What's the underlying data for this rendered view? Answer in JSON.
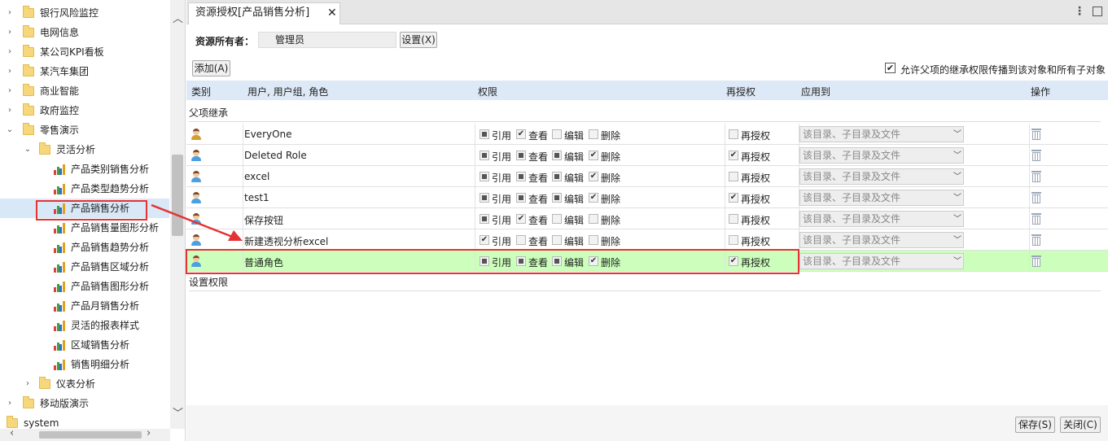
{
  "tree": {
    "items": [
      {
        "label": "银行风险监控",
        "type": "folder",
        "toggle": "›"
      },
      {
        "label": "电网信息",
        "type": "folder",
        "toggle": "›"
      },
      {
        "label": "某公司KPI看板",
        "type": "folder",
        "toggle": "›"
      },
      {
        "label": "某汽车集团",
        "type": "folder",
        "toggle": "›"
      },
      {
        "label": "商业智能",
        "type": "folder",
        "toggle": "›"
      },
      {
        "label": "政府监控",
        "type": "folder",
        "toggle": "›"
      },
      {
        "label": "零售演示",
        "type": "folder",
        "toggle": "⌄"
      },
      {
        "label": "灵活分析",
        "type": "folder",
        "toggle": "⌄"
      },
      {
        "label": "产品类别销售分析",
        "type": "report"
      },
      {
        "label": "产品类型趋势分析",
        "type": "report"
      },
      {
        "label": "产品销售分析",
        "type": "report",
        "selected": true
      },
      {
        "label": "产品销售量图形分析",
        "type": "report"
      },
      {
        "label": "产品销售趋势分析",
        "type": "report"
      },
      {
        "label": "产品销售区域分析",
        "type": "report"
      },
      {
        "label": "产品销售图形分析",
        "type": "report"
      },
      {
        "label": "产品月销售分析",
        "type": "report"
      },
      {
        "label": "灵活的报表样式",
        "type": "report"
      },
      {
        "label": "区域销售分析",
        "type": "report"
      },
      {
        "label": "销售明细分析",
        "type": "report"
      },
      {
        "label": "仪表分析",
        "type": "folder",
        "toggle": "›"
      },
      {
        "label": "移动版演示",
        "type": "folder",
        "toggle": "›"
      },
      {
        "label": "system",
        "type": "folder",
        "toggle": ""
      }
    ]
  },
  "tab": {
    "title": "资源授权[产品销售分析]",
    "close": "✕"
  },
  "window": {
    "menu": "⋮"
  },
  "owner": {
    "label": "资源所有者：",
    "value": "管理员",
    "set_button": "设置(X)"
  },
  "toolbar": {
    "add_button": "添加(A)",
    "inherit_label": "允许父项的继承权限传播到该对象和所有子对象",
    "inherit_checked": "✔"
  },
  "table": {
    "headers": [
      "类别",
      "用户, 用户组, 角色",
      "权限",
      "再授权",
      "应用到",
      "操作"
    ],
    "section_inherit": "父项继承",
    "section_set": "设置权限",
    "perm_labels": [
      "引用",
      "查看",
      "编辑",
      "删除"
    ],
    "regrant_label": "再授权",
    "apply_value": "该目录、子目录及文件",
    "rows": [
      {
        "name": "EveryOne",
        "group": true,
        "perms": [
          "p",
          "c",
          "",
          ""
        ],
        "regrant": ""
      },
      {
        "name": "Deleted Role",
        "group": false,
        "perms": [
          "p",
          "p",
          "p",
          "c"
        ],
        "regrant": "c"
      },
      {
        "name": "excel",
        "group": false,
        "perms": [
          "p",
          "p",
          "p",
          "c"
        ],
        "regrant": ""
      },
      {
        "name": "test1",
        "group": false,
        "perms": [
          "p",
          "p",
          "p",
          "c"
        ],
        "regrant": "c"
      },
      {
        "name": "保存按钮",
        "group": false,
        "perms": [
          "p",
          "c",
          "",
          ""
        ],
        "regrant": ""
      },
      {
        "name": "新建透视分析excel",
        "group": false,
        "perms": [
          "c",
          "",
          "",
          ""
        ],
        "regrant": ""
      },
      {
        "name": "普通角色",
        "group": false,
        "perms": [
          "p",
          "p",
          "p",
          "c"
        ],
        "regrant": "c",
        "highlight": true
      }
    ]
  },
  "footer": {
    "save_button": "保存(S)",
    "close_button": "关闭(C)"
  },
  "colors": {
    "highlight_row": "#ccffbb",
    "annotation_red": "#e53333",
    "header_bg": "#dde9f6"
  }
}
